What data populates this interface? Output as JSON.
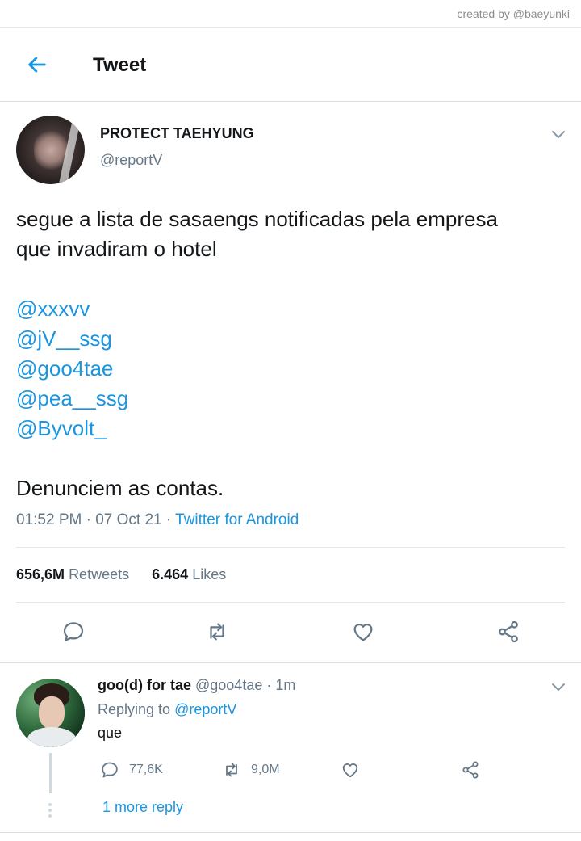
{
  "credit": "created by @baeyunki",
  "header": {
    "title": "Tweet",
    "back_icon": "arrow-left-icon",
    "accent": "#1b95e0"
  },
  "tweet": {
    "author_name": "PROTECT TAEHYUNG",
    "author_handle": "@reportV",
    "text_line1": "segue a lista de sasaengs notificadas pela empresa",
    "text_line2": "que invadiram o hotel",
    "mentions": [
      "@xxxvv",
      "@jV__ssg",
      "@goo4tae",
      "@pea__ssg",
      "@Byvolt_"
    ],
    "closing": "Denunciem as contas.",
    "timestamp": "01:52 PM · 07 Oct 21 · ",
    "source": "Twitter for Android",
    "retweets_count": "656,6M",
    "retweets_label": "Retweets",
    "likes_count": "6.464",
    "likes_label": "Likes"
  },
  "reply": {
    "name": "goo(d) for tae",
    "handle_time": "@goo4tae · 1m",
    "replying_label": "Replying to",
    "replying_to": "@reportV",
    "text": "que",
    "reply_count": "77,6K",
    "retweet_count": "9,0M",
    "more_replies": "1 more reply"
  }
}
